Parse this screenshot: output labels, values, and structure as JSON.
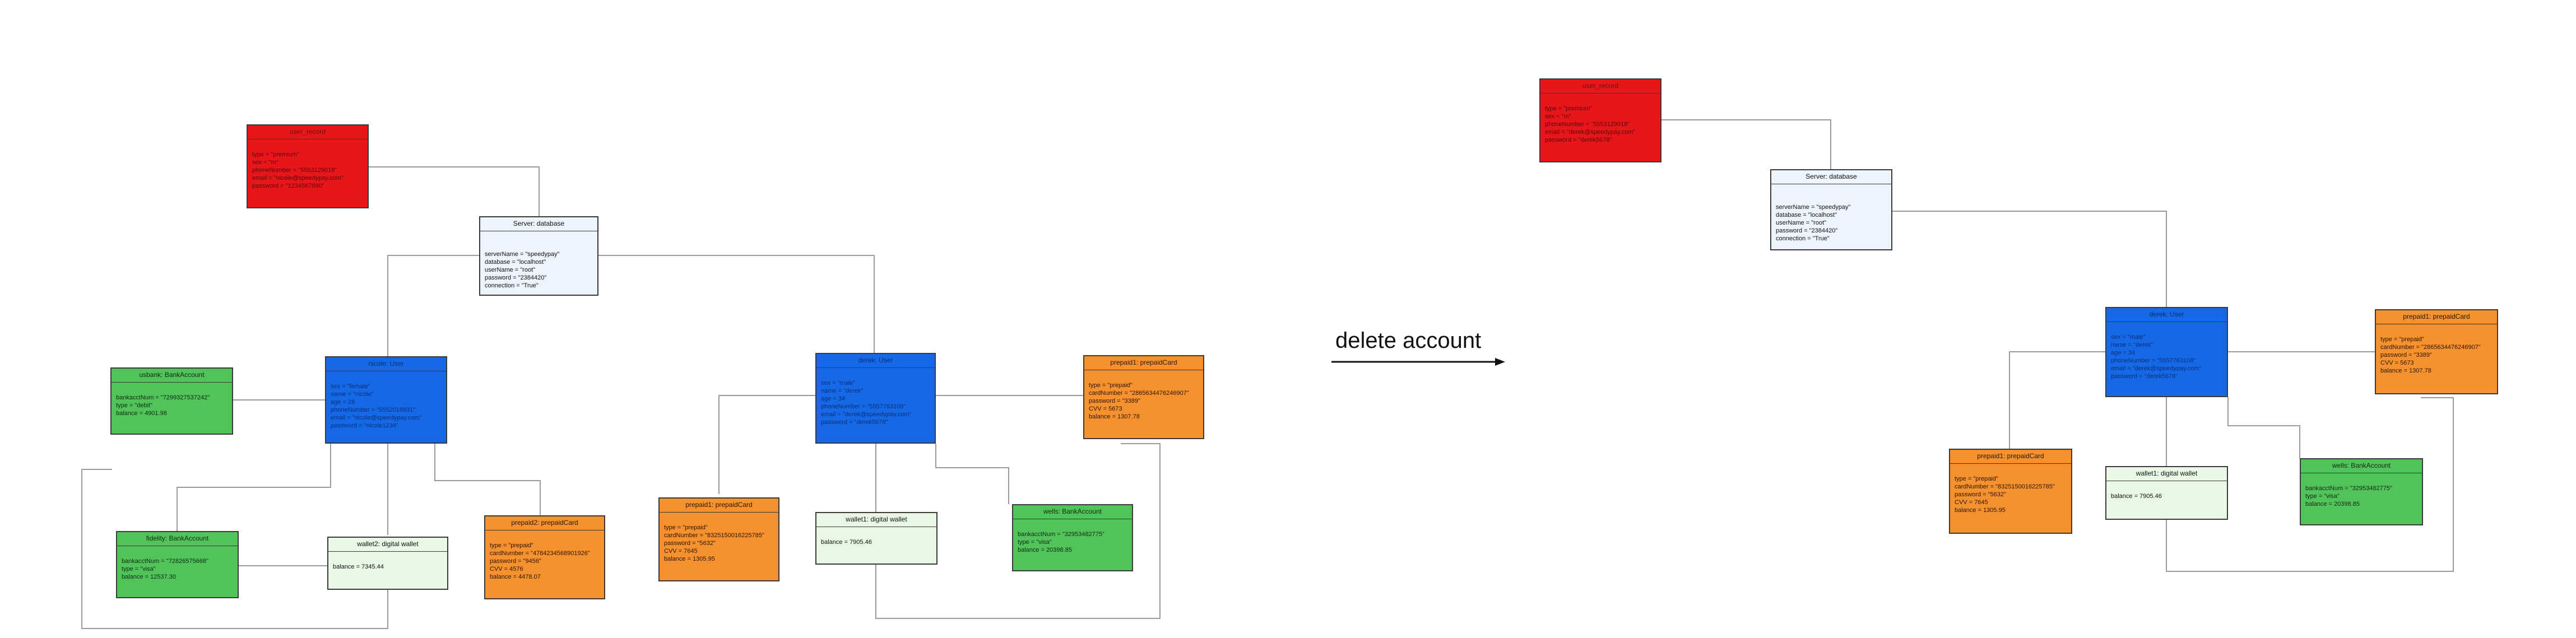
{
  "caption": "delete account",
  "before": {
    "user_red": {
      "title": "user_record",
      "attrs": [
        "type = \"premium\"",
        "sex = \"m\"",
        "phoneNumber = \"5553129018\"",
        "email = \"nicole@speedypay.com\"",
        "password = \"1234567890\""
      ]
    },
    "server": {
      "title": "Server: database",
      "attrs": [
        "serverName = \"speedypay\"",
        "database = \"localhost\"",
        "userName = \"root\"",
        "password = \"2384420\"",
        "connection = \"True\""
      ]
    },
    "user_left": {
      "title": "nicole: User",
      "attrs": [
        "sex = \"female\"",
        "name = \"nicole\"",
        "age = 28",
        "phoneNumber = \"5552018831\"",
        "email = \"nicole@speedypay.com\"",
        "password = \"nicole1234\""
      ]
    },
    "user_right": {
      "title": "derek: User",
      "attrs": [
        "sex = \"male\"",
        "name = \"derek\"",
        "age = 34",
        "phoneNumber = \"5557763108\"",
        "email = \"derek@speedypay.com\"",
        "password = \"derek5678\""
      ]
    },
    "bank_left1": {
      "title": "usbank: BankAccount",
      "attrs": [
        "bankacctNum = \"7299327537242\"",
        "type = \"debit\"",
        "balance = 4901.98"
      ]
    },
    "bank_left2": {
      "title": "fidelity: BankAccount",
      "attrs": [
        "bankacctNum = \"72826575668\"",
        "type = \"visa\"",
        "balance = 12537.30"
      ]
    },
    "wallet_left": {
      "title": "wallet2: digital wallet",
      "attrs": [
        "balance = 7345.44"
      ]
    },
    "prepaid_left": {
      "title": "prepaid2: prepaidCard",
      "attrs": [
        "type = \"prepaid\"",
        "cardNumber = \"4784234568901926\"",
        "password = \"9456\"",
        "CVV = 4576",
        "balance = 4478.07"
      ]
    },
    "prepaid_mid": {
      "title": "prepaid1: prepaidCard",
      "attrs": [
        "type = \"prepaid\"",
        "cardNumber = \"8325150016225785\"",
        "password = \"5632\"",
        "CVV = 7645",
        "balance = 1305.95"
      ]
    },
    "wallet_mid": {
      "title": "wallet1: digital wallet",
      "attrs": [
        "balance = 7905.46"
      ]
    },
    "bank_right": {
      "title": "wells: BankAccount",
      "attrs": [
        "bankacctNum = \"32953482775\"",
        "type = \"visa\"",
        "balance = 20398.85"
      ]
    },
    "prepaid_right": {
      "title": "prepaid1: prepaidCard",
      "attrs": [
        "type = \"prepaid\"",
        "cardNumber = \"2865634476246907\"",
        "password = \"3389\"",
        "CVV = 5673",
        "balance = 1307.78"
      ]
    }
  },
  "after": {
    "user_red": {
      "title": "user_record",
      "attrs": [
        "type = \"premium\"",
        "sex = \"m\"",
        "phoneNumber = \"5553129018\"",
        "email = \"derek@speedypay.com\"",
        "password = \"derek5678\""
      ]
    },
    "server": {
      "title": "Server: database",
      "attrs": [
        "serverName = \"speedypay\"",
        "database = \"localhost\"",
        "userName = \"root\"",
        "password = \"2384420\"",
        "connection = \"True\""
      ]
    },
    "user": {
      "title": "derek: User",
      "attrs": [
        "sex = \"male\"",
        "name = \"derek\"",
        "age = 34",
        "phoneNumber = \"5557763108\"",
        "email = \"derek@speedypay.com\"",
        "password = \"derek5678\""
      ]
    },
    "prepaid_top": {
      "title": "prepaid1: prepaidCard",
      "attrs": [
        "type = \"prepaid\"",
        "cardNumber = \"2865634476246907\"",
        "password = \"3389\"",
        "CVV = 5673",
        "balance = 1307.78"
      ]
    },
    "prepaid_left": {
      "title": "prepaid1: prepaidCard",
      "attrs": [
        "type = \"prepaid\"",
        "cardNumber = \"8325150016225785\"",
        "password = \"5632\"",
        "CVV = 7645",
        "balance = 1305.95"
      ]
    },
    "wallet": {
      "title": "wallet1: digital wallet",
      "attrs": [
        "balance = 7905.46"
      ]
    },
    "bank": {
      "title": "wells: BankAccount",
      "attrs": [
        "bankacctNum = \"32953482775\"",
        "type = \"visa\"",
        "balance = 20398.85"
      ]
    }
  }
}
